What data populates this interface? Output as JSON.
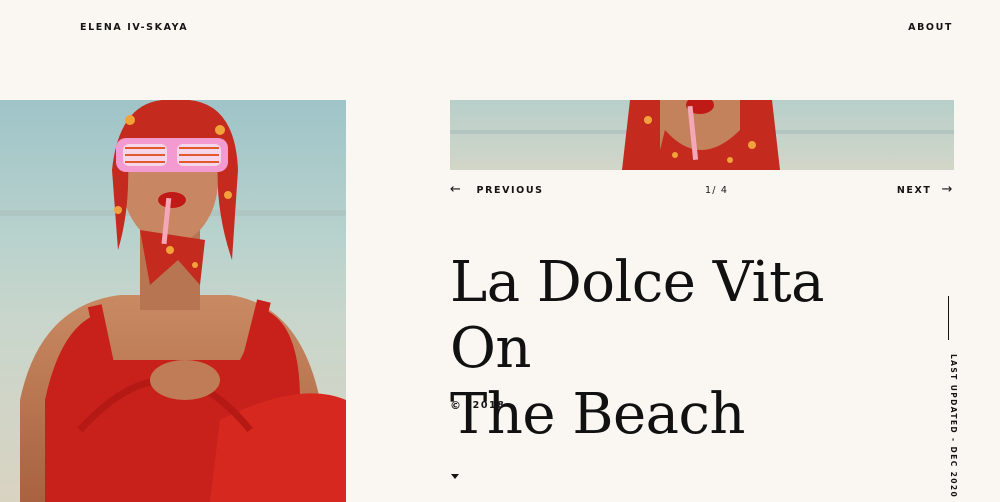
{
  "header": {
    "brand": "ELENA IV-SKAYA",
    "about_label": "ABOUT"
  },
  "gallery": {
    "previous_label": "PREVIOUS",
    "next_label": "NEXT",
    "counter": "1/ 4",
    "previous_icon": "arrow-left-icon",
    "next_icon": "arrow-right-icon"
  },
  "article": {
    "title_line1": "La Dolce Vita On",
    "title_line2": "The Beach",
    "copyright_symbol": "©",
    "year": "2018"
  },
  "sidebar": {
    "last_updated": "LAST UPDATED - DEC 2020"
  },
  "scroll": {
    "icon": "caret-down-icon"
  },
  "colors": {
    "background": "#faf7f2",
    "text": "#141414",
    "accent_red": "#c8211c"
  }
}
